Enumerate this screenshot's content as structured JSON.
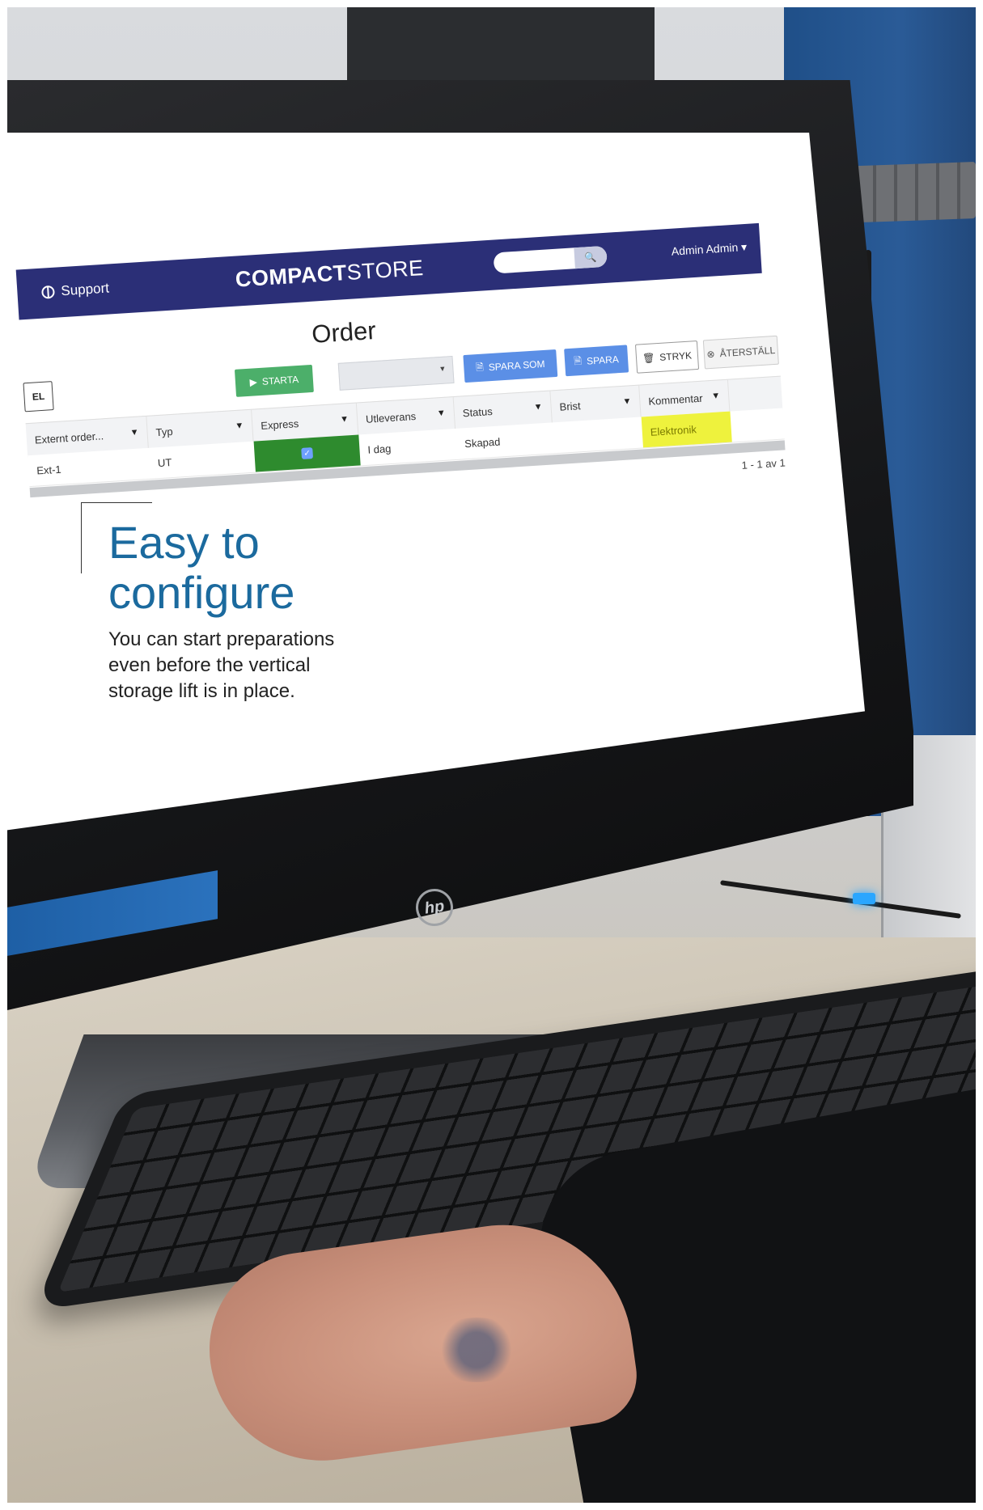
{
  "app": {
    "support_label": "Support",
    "brand_bold": "COMPACT",
    "brand_light": "STORE",
    "user_label": "Admin Admin ▾",
    "page_title": "Order",
    "toolbar": {
      "partial_label": "EL",
      "start_label": "STARTA",
      "save_as_label": "SPARA SOM",
      "save_label": "SPARA",
      "delete_label": "STRYK",
      "reset_label": "ÅTERSTÄLL"
    },
    "columns": [
      "Externt order...",
      "Typ",
      "Express",
      "Utleverans",
      "Status",
      "Brist",
      "Kommentar"
    ],
    "rows": [
      {
        "external_order": "Ext-1",
        "type": "UT",
        "express": true,
        "delivery": "I dag",
        "status": "Skapad",
        "shortage": "",
        "comment": "Elektronik"
      }
    ],
    "pager": "1 - 1 av 1"
  },
  "overlay": {
    "headline_line1": "Easy to",
    "headline_line2": "configure",
    "body_line1": "You can start preparations",
    "body_line2": "even before the vertical",
    "body_line3": "storage lift is in place."
  },
  "colors": {
    "header": "#2b2f77",
    "start_button": "#4caf6a",
    "save_buttons": "#5b8fe6",
    "express_cell": "#2e8b2e",
    "comment_cell": "#eef23d",
    "headline": "#1b6a9e"
  }
}
